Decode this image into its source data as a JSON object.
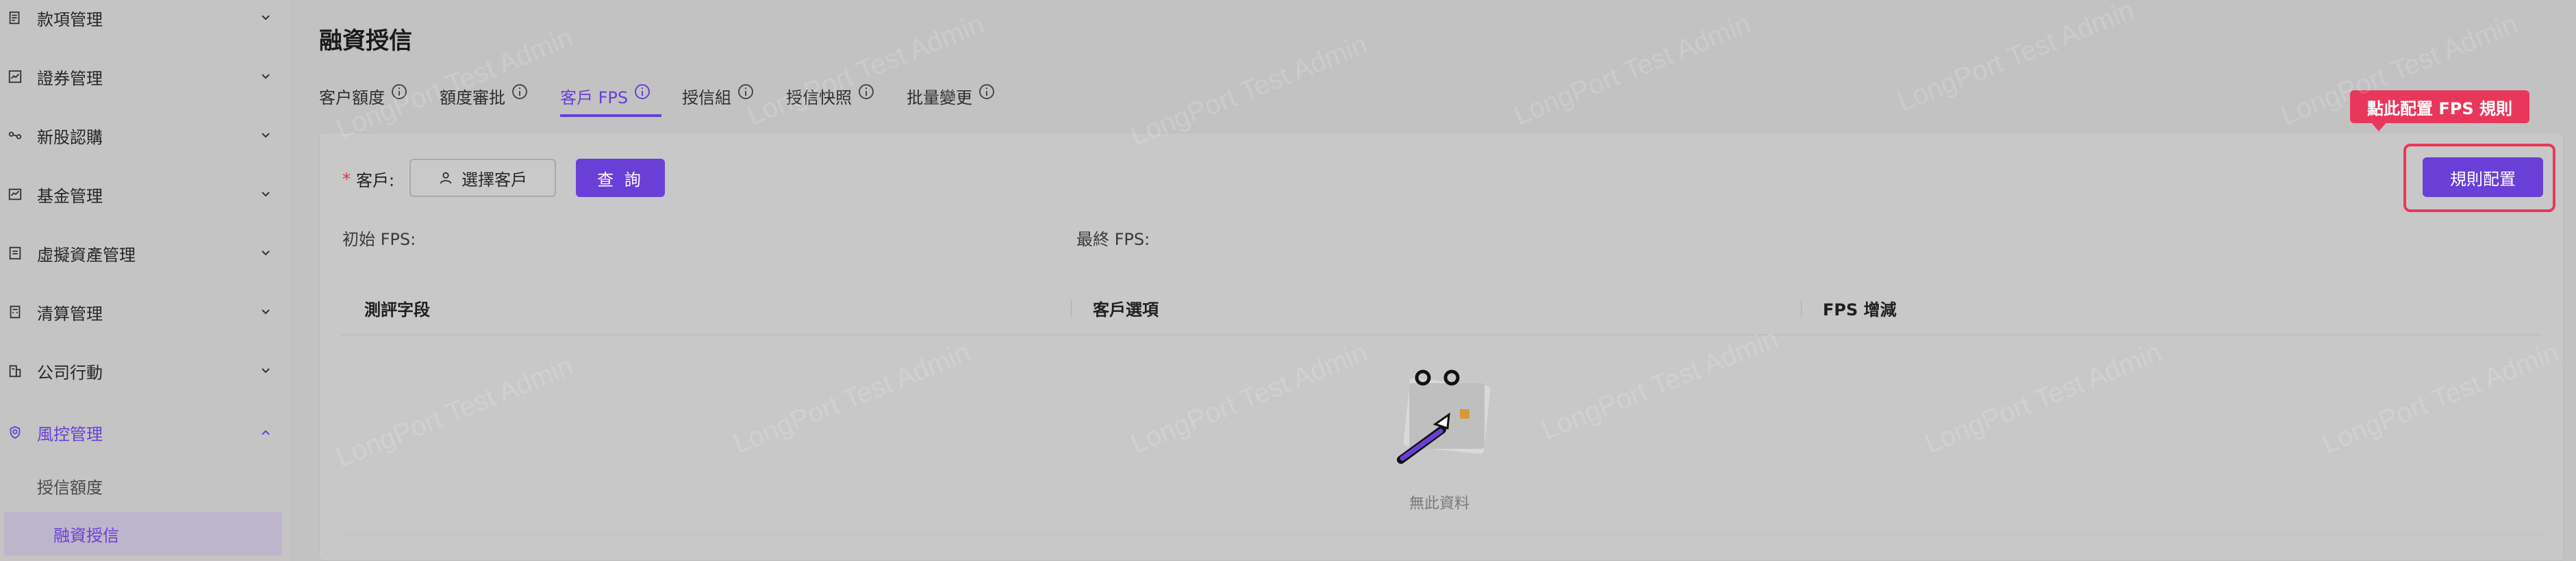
{
  "sidebar": {
    "items": [
      {
        "label": "款項管理",
        "icon": "ledger-icon",
        "expanded": false
      },
      {
        "label": "證券管理",
        "icon": "chart-box-icon",
        "expanded": false
      },
      {
        "label": "新股認購",
        "icon": "link-icon",
        "expanded": false
      },
      {
        "label": "基金管理",
        "icon": "trend-box-icon",
        "expanded": false
      },
      {
        "label": "虛擬資產管理",
        "icon": "document-icon",
        "expanded": false
      },
      {
        "label": "清算管理",
        "icon": "calculator-icon",
        "expanded": false
      },
      {
        "label": "公司行動",
        "icon": "building-icon",
        "expanded": false
      },
      {
        "label": "風控管理",
        "icon": "shield-icon",
        "expanded": true
      }
    ],
    "sub_items": [
      {
        "label": "授信額度",
        "selected": false
      },
      {
        "label": "融資授信",
        "selected": true
      }
    ]
  },
  "page": {
    "title": "融資授信"
  },
  "tabs": [
    {
      "label": "客户額度",
      "active": false
    },
    {
      "label": "額度審批",
      "active": false
    },
    {
      "label": "客戶 FPS",
      "active": true
    },
    {
      "label": "授信組",
      "active": false
    },
    {
      "label": "授信快照",
      "active": false
    },
    {
      "label": "批量變更",
      "active": false
    }
  ],
  "filter": {
    "required_mark": "*",
    "customer_label": "客戶:",
    "select_customer": "選擇客戶",
    "query_button": "查 詢"
  },
  "fps": {
    "initial_label": "初始 FPS:",
    "final_label": "最終 FPS:"
  },
  "table": {
    "columns": [
      "測評字段",
      "客戶選項",
      "FPS 增減"
    ],
    "rows": [],
    "empty_text": "無此資料"
  },
  "rule_button": "規則配置",
  "callout": "點此配置 FPS 規則",
  "watermark_text": "LongPort Test Admin",
  "colors": {
    "accent": "#6a3fd8",
    "highlight": "#e8375a",
    "background": "#c2c2c2"
  }
}
